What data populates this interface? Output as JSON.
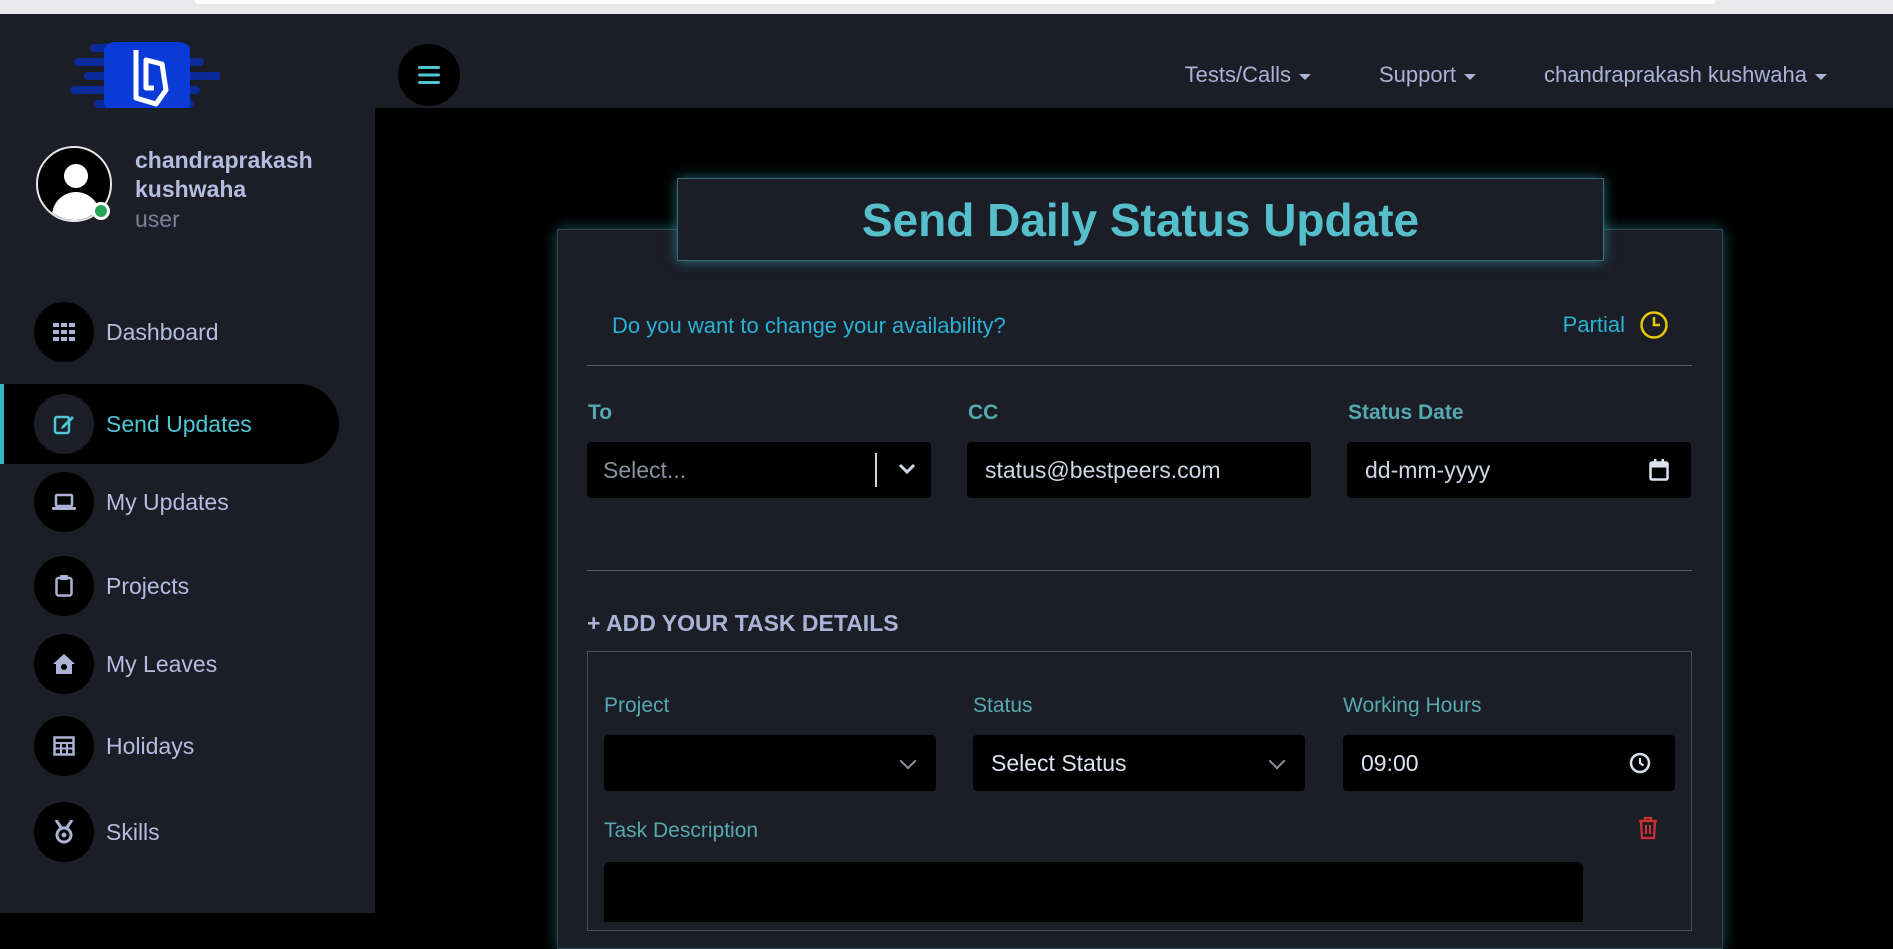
{
  "header": {
    "nav": [
      {
        "label": "Tests/Calls"
      },
      {
        "label": "Support"
      },
      {
        "label": "chandraprakash kushwaha"
      }
    ]
  },
  "profile": {
    "name": "chandraprakash kushwaha",
    "role": "user"
  },
  "sidebar": {
    "items": [
      {
        "label": "Dashboard",
        "icon": "grid-icon"
      },
      {
        "label": "Send Updates",
        "icon": "edit-icon",
        "active": true
      },
      {
        "label": "My Updates",
        "icon": "laptop-icon"
      },
      {
        "label": "Projects",
        "icon": "clipboard-icon"
      },
      {
        "label": "My Leaves",
        "icon": "home-icon"
      },
      {
        "label": "Holidays",
        "icon": "table-icon"
      },
      {
        "label": "Skills",
        "icon": "medal-icon"
      }
    ]
  },
  "form": {
    "title": "Send Daily Status Update",
    "availability_question": "Do you want to change your availability?",
    "availability_value": "Partial",
    "to_label": "To",
    "to_placeholder": "Select...",
    "cc_label": "CC",
    "cc_value": "status@bestpeers.com",
    "date_label": "Status Date",
    "date_placeholder": "dd-mm-yyyy",
    "add_task_label": "+ ADD YOUR TASK DETAILS",
    "task": {
      "project_label": "Project",
      "project_value": "",
      "status_label": "Status",
      "status_value": "Select Status",
      "hours_label": "Working Hours",
      "hours_value": "09:00",
      "description_label": "Task Description"
    }
  },
  "colors": {
    "accent": "#4fc6d6",
    "availability": "#29b2d3",
    "clock": "#e6c700",
    "delete": "#d62d2d",
    "online": "#27a35a"
  }
}
